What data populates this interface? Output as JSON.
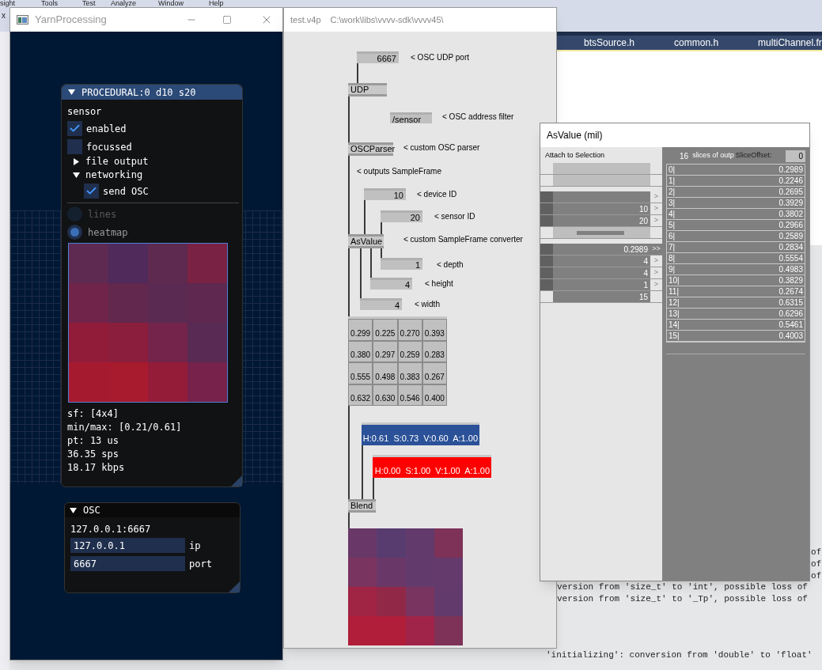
{
  "ide": {
    "menu": [
      "sight",
      "Tools",
      "Test",
      "Analyze",
      "Window",
      "Help"
    ],
    "tab_close": "x",
    "editor_tabs": [
      "btsSource.h",
      "common.h",
      "multiChannel.fr"
    ],
    "output_line_ends": [
      "of",
      "of",
      "of"
    ],
    "output_lines": [
      "version from 'size_t' to 'int', possible loss of",
      "version from 'size_t' to '_Tp', possible loss of"
    ],
    "output_bottom_line": "'initializing': conversion from 'double' to 'float'"
  },
  "yarn_window": {
    "title": "YarnProcessing",
    "procedural_panel": {
      "title": "PROCEDURAL:0 d10 s20",
      "expanded": true,
      "section_label": "sensor",
      "checkboxes": [
        {
          "label": "enabled",
          "checked": true
        },
        {
          "label": "focussed",
          "checked": false
        }
      ],
      "tree": [
        {
          "label": "file output",
          "expanded": false
        },
        {
          "label": "networking",
          "expanded": true,
          "children": [
            {
              "label": "send OSC",
              "checked": true
            }
          ]
        }
      ],
      "radios": [
        {
          "label": "lines",
          "selected": false,
          "disabled": true
        },
        {
          "label": "heatmap",
          "selected": true,
          "disabled": false
        }
      ],
      "stats": [
        "sf: [4x4]",
        "min/max: [0.21/0.61]",
        "pt: 13 us",
        "36.35 sps",
        "18.17 kbps"
      ]
    },
    "osc_panel": {
      "title": "OSC",
      "expanded": true,
      "address": "127.0.0.1:6667",
      "fields": [
        {
          "value": "127.0.0.1",
          "label": "ip"
        },
        {
          "value": "6667",
          "label": "port"
        }
      ]
    }
  },
  "patch_window": {
    "title": "test.v4p",
    "path": "C:\\work\\libs\\vvvv-sdk\\vvvv45\\",
    "nodes": [
      {
        "kind": "iobox",
        "value": "6667"
      },
      {
        "kind": "node",
        "name": "UDP"
      },
      {
        "kind": "iobox",
        "value": "/sensor"
      },
      {
        "kind": "node",
        "name": "OSCParser"
      },
      {
        "kind": "iobox",
        "value": "10"
      },
      {
        "kind": "iobox",
        "value": "20"
      },
      {
        "kind": "node",
        "name": "AsValue"
      },
      {
        "kind": "iobox",
        "value": "1"
      },
      {
        "kind": "iobox",
        "value": "4"
      },
      {
        "kind": "iobox",
        "value": "4"
      },
      {
        "kind": "matrix",
        "rows": [
          [
            "0.299",
            "0.225",
            "0.270",
            "0.393"
          ],
          [
            "0.380",
            "0.297",
            "0.259",
            "0.283"
          ],
          [
            "0.555",
            "0.498",
            "0.383",
            "0.267"
          ],
          [
            "0.632",
            "0.630",
            "0.546",
            "0.400"
          ]
        ]
      },
      {
        "kind": "color",
        "value": "H:0.61  S:0.73  V:0.60  A:1.00",
        "color": "#2b5198"
      },
      {
        "kind": "color",
        "value": "H:0.00  S:1.00  V:1.00  A:1.00",
        "color": "#ff0000"
      },
      {
        "kind": "node",
        "name": "Blend"
      },
      {
        "kind": "preview"
      }
    ],
    "comments": [
      "< OSC UDP port",
      "< OSC address filter",
      "< custom OSC parser",
      "< outputs SampleFrame",
      "< device ID",
      "< sensor ID",
      "< custom SampleFrame converter",
      "< depth",
      "< height",
      "< width"
    ]
  },
  "inspector_window": {
    "title": "AsValue (mil)",
    "attach_label": "Attach to Selection",
    "pins": [
      {
        "kind": "blank"
      },
      {
        "kind": "blank"
      },
      {
        "kind": "input",
        "arrow": ">"
      },
      {
        "kind": "input",
        "value": "10",
        "arrow": ">"
      },
      {
        "kind": "input",
        "value": "20",
        "arrow": ">"
      },
      {
        "kind": "bar"
      },
      {
        "kind": "output",
        "value": "0.2989",
        "arrow": ">>"
      },
      {
        "kind": "input",
        "value": "4",
        "arrow": ">"
      },
      {
        "kind": "input",
        "value": "4",
        "arrow": ">"
      },
      {
        "kind": "input",
        "value": "1",
        "arrow": ">"
      },
      {
        "kind": "config",
        "value": "15"
      }
    ],
    "slice_count": "16",
    "slice_label": "slices of outp",
    "offset_label": "SliceOffset:",
    "offset_value": "0",
    "slices": [
      {
        "index": "0|",
        "value": "0.2989"
      },
      {
        "index": "1|",
        "value": "0.2246"
      },
      {
        "index": "2|",
        "value": "0.2695"
      },
      {
        "index": "3|",
        "value": "0.3929"
      },
      {
        "index": "4|",
        "value": "0.3802"
      },
      {
        "index": "5|",
        "value": "0.2966"
      },
      {
        "index": "6|",
        "value": "0.2589"
      },
      {
        "index": "7|",
        "value": "0.2834"
      },
      {
        "index": "8|",
        "value": "0.5554"
      },
      {
        "index": "9|",
        "value": "0.4983"
      },
      {
        "index": "10|",
        "value": "0.3829"
      },
      {
        "index": "11|",
        "value": "0.2674"
      },
      {
        "index": "12|",
        "value": "0.6315"
      },
      {
        "index": "13|",
        "value": "0.6296"
      },
      {
        "index": "14|",
        "value": "0.5461"
      },
      {
        "index": "15|",
        "value": "0.4003"
      }
    ]
  }
}
